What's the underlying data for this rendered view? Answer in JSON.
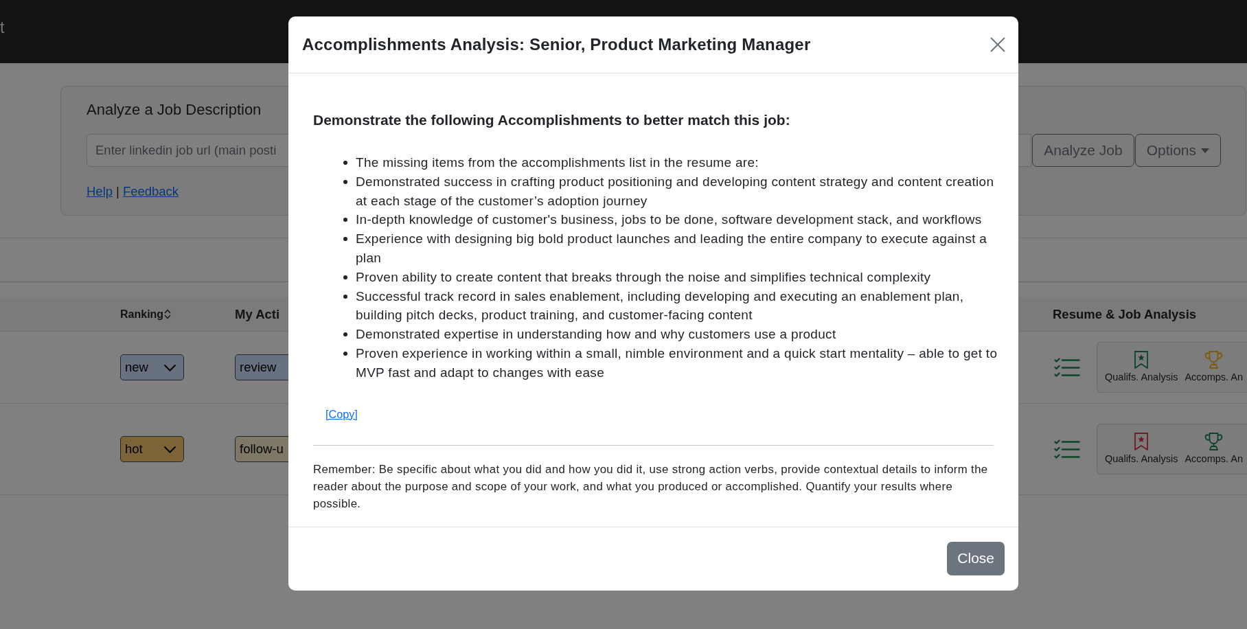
{
  "navbar": {
    "brand": "t"
  },
  "job_form": {
    "title": "Analyze a Job Description",
    "url_field": {
      "placeholder": "Enter linkedin job url (main posti"
    },
    "analyze_button": "Analyze Job",
    "options_button": "Options",
    "links": [
      "Help",
      "Feedback"
    ],
    "link_separator": "|"
  },
  "table": {
    "columns": [
      {
        "label": "Ranking",
        "sortable": true
      },
      {
        "label": "My Acti",
        "sortable": false
      },
      {
        "label": "Resume & Job Analysis",
        "sortable": false
      }
    ],
    "rows": [
      {
        "ranking": {
          "value": "new",
          "color": "#677180"
        },
        "action": {
          "value": "review",
          "color": "#677180"
        },
        "analyses": [
          {
            "kind": "bookmark",
            "label": "Qualifs. Analysis",
            "color": "#0c432a"
          },
          {
            "kind": "trophy",
            "label": "Accomps. An",
            "color": "#7d5a0e"
          }
        ]
      },
      {
        "ranking": {
          "value": "hot",
          "color": "#7d6338"
        },
        "action": {
          "value": "follow-u",
          "color": "#7e7866"
        },
        "analyses": [
          {
            "kind": "bookmark",
            "label": "Qualifs. Analysis",
            "color": "#6e1a22"
          },
          {
            "kind": "trophy",
            "label": "Accomps. An",
            "color": "#0c432a"
          }
        ]
      }
    ]
  },
  "modal": {
    "title": "Accomplishments Analysis: Senior, Product Marketing Manager",
    "heading": "Demonstrate the following Accomplishments to better match this job:",
    "items": [
      "The missing items from the accomplishments list in the resume are:",
      "Demonstrated success in crafting product positioning and developing content strategy and content creation at each stage of the customer’s adoption journey",
      "In-depth knowledge of customer's business, jobs to be done, software development stack, and workflows",
      "Experience with designing big bold product launches and leading the entire company to execute against a plan",
      "Proven ability to create content that breaks through the noise and simplifies technical complexity",
      "Successful track record in sales enablement, including developing and executing an enablement plan, building pitch decks, product training, and customer-facing content",
      "Demonstrated expertise in understanding how and why customers use a product",
      "Proven experience in working within a small, nimble environment and a quick start mentality – able to get to MVP fast and adapt to changes with ease"
    ],
    "copy_link": "[Copy]",
    "note": "Remember: Be specific about what you did and how you did it, use strong action verbs, provide contextual details to inform the reader about the purpose and scope of your work, and what you produced or accomplished. Quantify your results where possible.",
    "close_button": "Close"
  }
}
